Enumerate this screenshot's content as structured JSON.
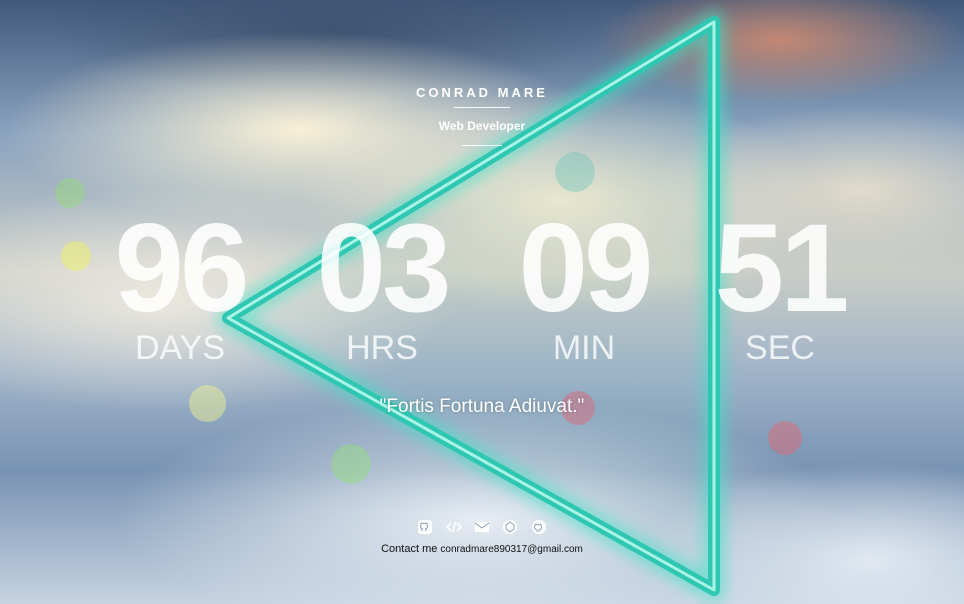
{
  "header": {
    "name": "CONRAD MARE",
    "role": "Web Developer"
  },
  "countdown": [
    {
      "value": "96",
      "label": "DAYS"
    },
    {
      "value": "03",
      "label": "HRS"
    },
    {
      "value": "09",
      "label": "MIN"
    },
    {
      "value": "51",
      "label": "SEC"
    }
  ],
  "quote": "\"Fortis Fortuna Adiuvat.\"",
  "social_icons": [
    "github-icon",
    "code-icon",
    "mail-icon",
    "codepen-icon",
    "github-octocat-icon"
  ],
  "contact": {
    "label": "Contact me",
    "email": "conradmare890317@gmail.com"
  },
  "colors": {
    "triangle": "#4fe0c4",
    "text": "#ffffff"
  }
}
